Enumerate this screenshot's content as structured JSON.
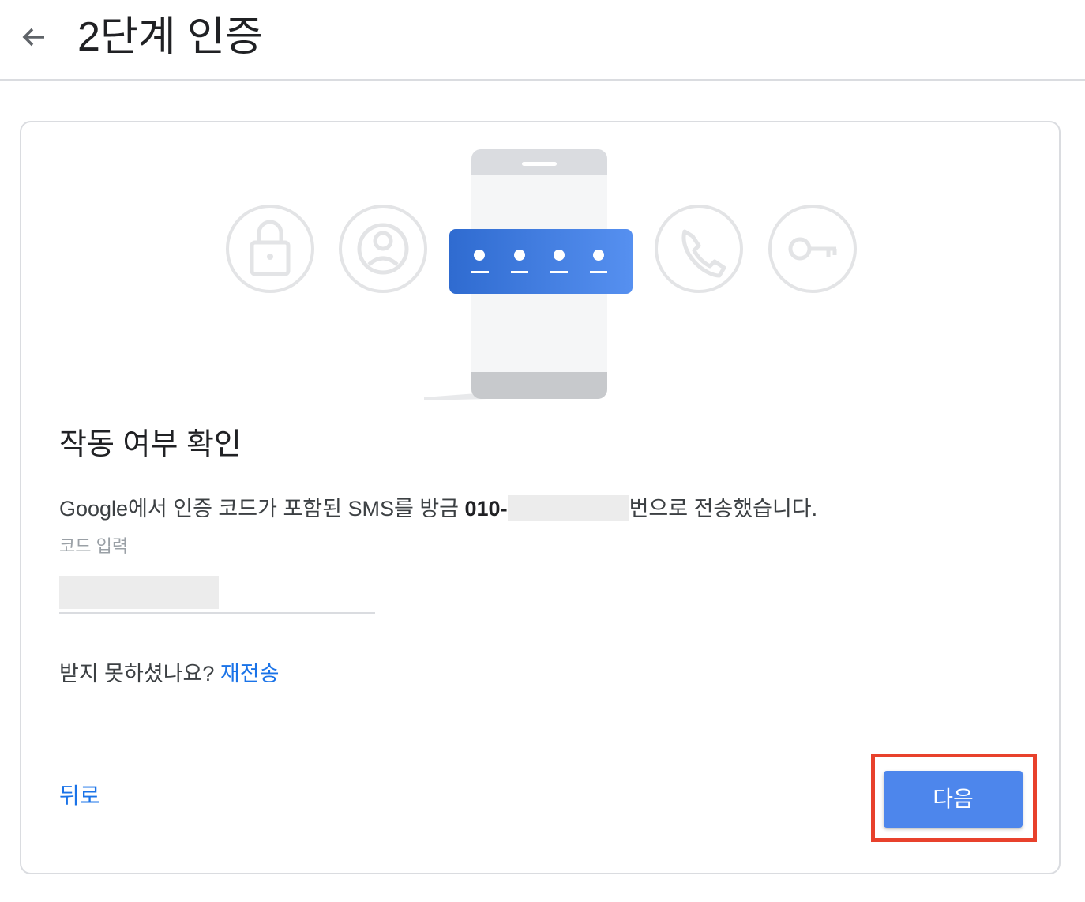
{
  "header": {
    "title": "2단계 인증",
    "back_icon": "arrow-left-icon"
  },
  "illustration": {
    "icons": [
      "lock-icon",
      "account-circle-icon",
      "phone-call-icon",
      "key-icon"
    ],
    "accent": "#3a78e0"
  },
  "main": {
    "section_title": "작동 여부 확인",
    "message_prefix": "Google에서 인증 코드가 포함된 SMS를 방금 ",
    "phone_prefix": "010-",
    "message_suffix": "번으로 전송했습니다.",
    "code_label": "코드 입력",
    "code_value": "",
    "resend_question": "받지 못하셨나요? ",
    "resend_link": "재전송"
  },
  "footer": {
    "back_label": "뒤로",
    "next_label": "다음"
  },
  "colors": {
    "link": "#1a73e8",
    "primary_button": "#4d86ec",
    "highlight": "#e8412c",
    "border": "#dadce0"
  }
}
